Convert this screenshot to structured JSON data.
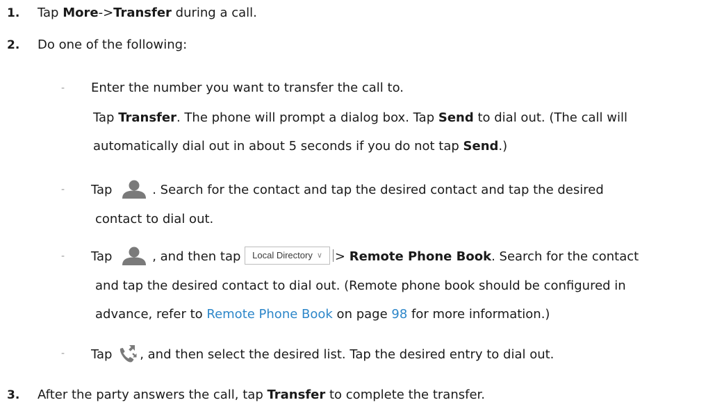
{
  "steps": [
    {
      "num": "1.",
      "pre": "Tap ",
      "b1": "More",
      "mid": "->",
      "b2": "Transfer",
      "post": " during a call."
    },
    {
      "num": "2.",
      "text": "Do one of the following:"
    },
    {
      "num": "3.",
      "pre": "After the party answers the call, tap ",
      "b1": "Transfer",
      "post": " to complete the transfer."
    }
  ],
  "option1": {
    "line1": "Enter the number you want to transfer the call to.",
    "l2_a": "Tap ",
    "l2_b": "Transfer",
    "l2_c": ". The phone will prompt a dialog box. Tap ",
    "l2_d": "Send",
    "l2_e": " to dial out. (The call will",
    "l3_a": "automatically dial out in about 5 seconds if you do not tap ",
    "l3_b": "Send",
    "l3_c": ".)"
  },
  "option2": {
    "tap": "Tap ",
    "rest": ". Search for the contact and tap the desired contact and tap the desired",
    "line2": "contact to dial out."
  },
  "option3": {
    "tap": "Tap ",
    "after_icon": ", and then tap ",
    "directory_label": "Local Directory",
    "arrow": "> ",
    "bold": "Remote Phone Book",
    "rest": ". Search for the contact",
    "line2": "and tap the desired contact to dial out. (Remote phone book should be configured in",
    "l3_a": "advance, refer to ",
    "l3_link": "Remote Phone Book",
    "l3_b": " on page ",
    "l3_page": "98",
    "l3_c": " for more information.)"
  },
  "option4": {
    "tap": "Tap ",
    "rest": ", and then select the desired list. Tap the desired entry to dial out."
  },
  "bullet": "-",
  "icons": {
    "contact": "contact-person-icon",
    "history": "call-history-icon"
  },
  "colors": {
    "link": "#2c86c9",
    "icon_gray": "#7a7a7a",
    "text": "#1a1a1a"
  }
}
